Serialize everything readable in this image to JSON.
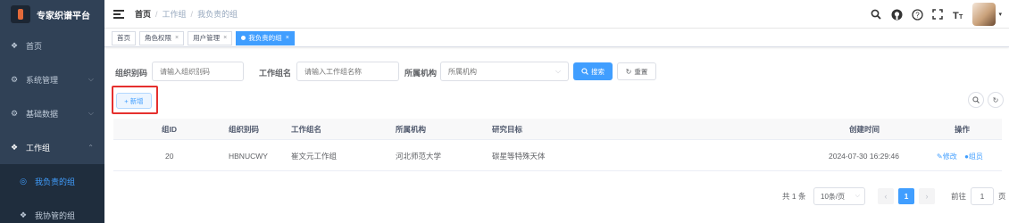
{
  "app": {
    "title": "专家织谱平台"
  },
  "sidebar": {
    "items": [
      {
        "label": "首页",
        "icon": "dashboard-icon"
      },
      {
        "label": "系统管理",
        "icon": "gear-icon"
      },
      {
        "label": "基础数据",
        "icon": "gear-icon"
      },
      {
        "label": "工作组",
        "icon": "group-icon"
      },
      {
        "label": "我负责的组",
        "icon": "circle-icon"
      },
      {
        "label": "我协管的组",
        "icon": "group-icon"
      }
    ]
  },
  "header": {
    "breadcrumb": [
      "首页",
      "工作组",
      "我负责的组"
    ]
  },
  "tags": [
    {
      "label": "首页"
    },
    {
      "label": "角色权限"
    },
    {
      "label": "用户管理"
    },
    {
      "label": "我负责的组"
    }
  ],
  "search": {
    "org_code_label": "组织别码",
    "org_code_placeholder": "请输入组织别码",
    "group_name_label": "工作组名",
    "group_name_placeholder": "请输入工作组名称",
    "institution_label": "所属机构",
    "institution_placeholder": "所属机构",
    "search_button": "搜索",
    "reset_button": "重置"
  },
  "toolbar": {
    "add_button": "新增"
  },
  "table": {
    "headers": [
      "组ID",
      "组织别码",
      "工作组名",
      "所属机构",
      "研究目标",
      "创建时间",
      "操作"
    ],
    "rows": [
      {
        "id": "20",
        "code": "HBNUCWY",
        "name": "崔文元工作组",
        "institution": "河北师范大学",
        "target": "碳星等特殊天体",
        "created": "2024-07-30 16:29:46",
        "edit": "修改",
        "members": "组员"
      }
    ]
  },
  "pagination": {
    "total": "共 1 条",
    "page_size": "10条/页",
    "current_page": "1",
    "goto_label": "前往",
    "goto_value": "1",
    "page_suffix": "页"
  },
  "colors": {
    "sidebar_bg": "#304156",
    "primary": "#409eff",
    "highlight": "#e5302e"
  }
}
